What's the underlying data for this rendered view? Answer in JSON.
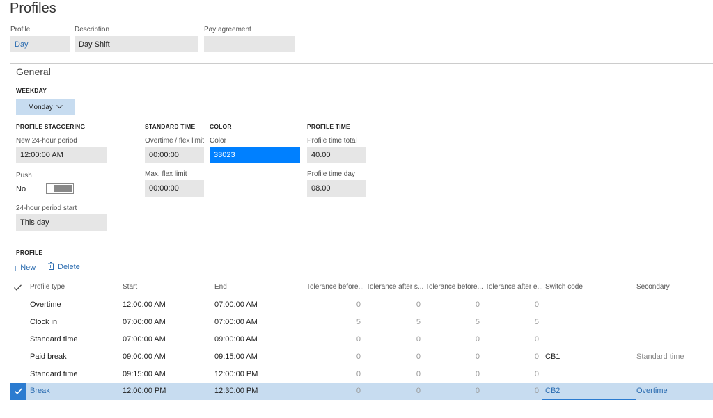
{
  "page": {
    "title": "Profiles"
  },
  "header_fields": {
    "profile": {
      "label": "Profile",
      "value": "Day"
    },
    "description": {
      "label": "Description",
      "value": "Day Shift"
    },
    "pay_agreement": {
      "label": "Pay agreement",
      "value": ""
    }
  },
  "general": {
    "title": "General",
    "weekday": {
      "section": "WEEKDAY",
      "value": "Monday"
    },
    "staggering": {
      "section": "PROFILE STAGGERING",
      "new_period_label": "New 24-hour period",
      "new_period_value": "12:00:00 AM",
      "push_label": "Push",
      "push_value": "No",
      "period_start_label": "24-hour period start",
      "period_start_value": "This day"
    },
    "standard_time": {
      "section": "STANDARD TIME",
      "overtime_label": "Overtime / flex limit",
      "overtime_value": "00:00:00",
      "max_flex_label": "Max. flex limit",
      "max_flex_value": "00:00:00"
    },
    "color": {
      "section": "COLOR",
      "label": "Color",
      "value": "33023",
      "swatch": "#0080ff"
    },
    "profile_time": {
      "section": "PROFILE TIME",
      "total_label": "Profile time total",
      "total_value": "40.00",
      "day_label": "Profile time day",
      "day_value": "08.00"
    }
  },
  "profile": {
    "section": "PROFILE",
    "new_label": "New",
    "delete_label": "Delete",
    "columns": [
      "Profile type",
      "Start",
      "End",
      "Tolerance before...",
      "Tolerance after s...",
      "Tolerance before...",
      "Tolerance after e...",
      "Switch code",
      "Secondary"
    ],
    "rows": [
      {
        "type": "Overtime",
        "start": "12:00:00 AM",
        "end": "07:00:00 AM",
        "t1": "0",
        "t2": "0",
        "t3": "0",
        "t4": "0",
        "switch": "",
        "secondary": ""
      },
      {
        "type": "Clock in",
        "start": "07:00:00 AM",
        "end": "07:00:00 AM",
        "t1": "5",
        "t2": "5",
        "t3": "5",
        "t4": "5",
        "switch": "",
        "secondary": ""
      },
      {
        "type": "Standard time",
        "start": "07:00:00 AM",
        "end": "09:00:00 AM",
        "t1": "0",
        "t2": "0",
        "t3": "0",
        "t4": "0",
        "switch": "",
        "secondary": ""
      },
      {
        "type": "Paid break",
        "start": "09:00:00 AM",
        "end": "09:15:00 AM",
        "t1": "0",
        "t2": "0",
        "t3": "0",
        "t4": "0",
        "switch": "CB1",
        "secondary": "Standard time"
      },
      {
        "type": "Standard time",
        "start": "09:15:00 AM",
        "end": "12:00:00 PM",
        "t1": "0",
        "t2": "0",
        "t3": "0",
        "t4": "0",
        "switch": "",
        "secondary": ""
      },
      {
        "type": "Break",
        "start": "12:00:00 PM",
        "end": "12:30:00 PM",
        "t1": "0",
        "t2": "0",
        "t3": "0",
        "t4": "0",
        "switch": "CB2",
        "secondary": "Overtime"
      }
    ]
  }
}
